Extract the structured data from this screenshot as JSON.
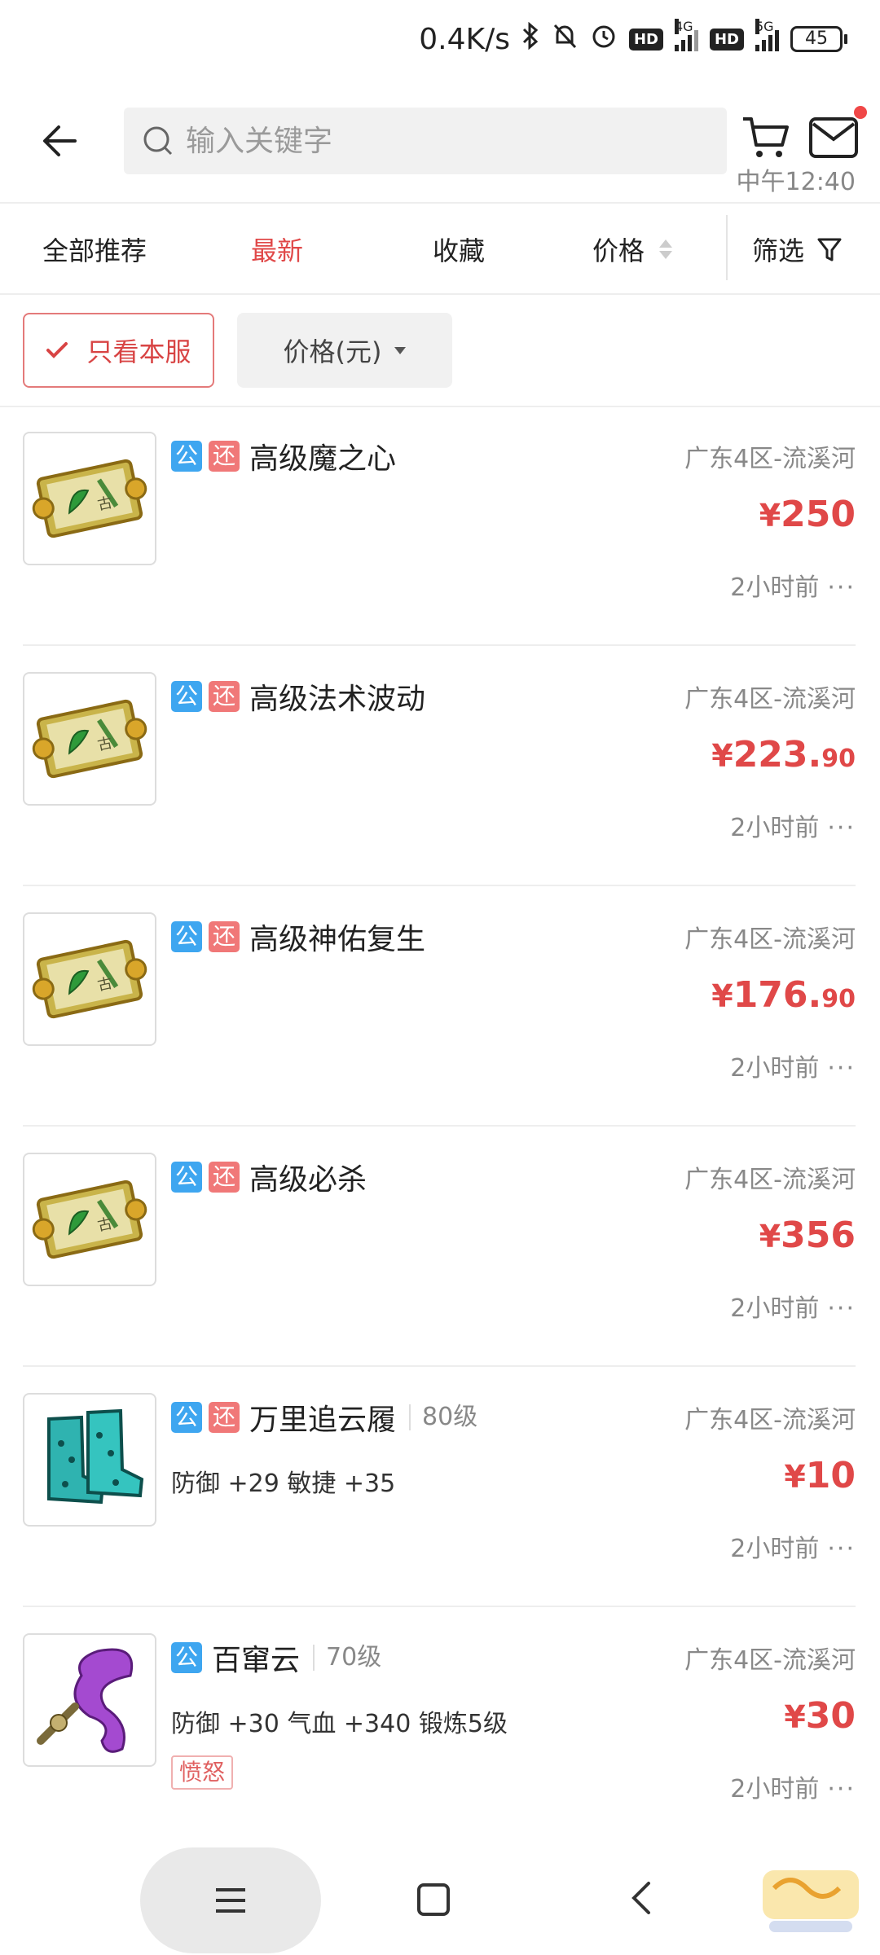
{
  "status_bar": {
    "time": "中午12:40",
    "speed": "0.4K/s",
    "net_4g": "4G",
    "net_5g": "5G",
    "hd": "HD",
    "battery": "45"
  },
  "header": {
    "search_placeholder": "输入关键字"
  },
  "tabs": {
    "all": "全部推荐",
    "newest": "最新",
    "favorites": "收藏",
    "price": "价格",
    "filter": "筛选"
  },
  "chips": {
    "server_only": "只看本服",
    "price_unit": "价格(元)"
  },
  "badges": {
    "gong": "公",
    "huan": "还"
  },
  "items": [
    {
      "name": "高级魔之心",
      "level": "",
      "server": "广东4区-流溪河",
      "price_int": "250",
      "price_dec": "",
      "attrs": "",
      "tag": "",
      "time": "2小时前",
      "icon": "scroll-icon",
      "huan": true
    },
    {
      "name": "高级法术波动",
      "level": "",
      "server": "广东4区-流溪河",
      "price_int": "223.",
      "price_dec": "90",
      "attrs": "",
      "tag": "",
      "time": "2小时前",
      "icon": "scroll-icon",
      "huan": true
    },
    {
      "name": "高级神佑复生",
      "level": "",
      "server": "广东4区-流溪河",
      "price_int": "176.",
      "price_dec": "90",
      "attrs": "",
      "tag": "",
      "time": "2小时前",
      "icon": "scroll-icon",
      "huan": true
    },
    {
      "name": "高级必杀",
      "level": "",
      "server": "广东4区-流溪河",
      "price_int": "356",
      "price_dec": "",
      "attrs": "",
      "tag": "",
      "time": "2小时前",
      "icon": "scroll-icon",
      "huan": true
    },
    {
      "name": "万里追云履",
      "level": "80级",
      "server": "广东4区-流溪河",
      "price_int": "10",
      "price_dec": "",
      "attrs": "防御 +29 敏捷 +35",
      "tag": "",
      "time": "2小时前",
      "icon": "boots-icon",
      "huan": true
    },
    {
      "name": "百窜云",
      "level": "70级",
      "server": "广东4区-流溪河",
      "price_int": "30",
      "price_dec": "",
      "attrs": "防御 +30 气血 +340 锻炼5级",
      "tag": "愤怒",
      "time": "2小时前",
      "icon": "ribbon-icon",
      "huan": false
    }
  ],
  "currency": "¥",
  "more_glyph": "···",
  "colors": {
    "accent": "#e04848",
    "badge_blue": "#3ea6f0",
    "badge_red": "#f07878"
  }
}
